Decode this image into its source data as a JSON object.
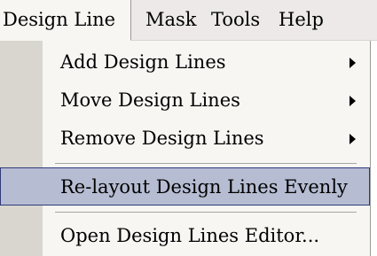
{
  "menubar": {
    "items": [
      {
        "label": "Design Line"
      },
      {
        "label": "Mask"
      },
      {
        "label": "Tools"
      },
      {
        "label": "Help"
      }
    ]
  },
  "dropdown": {
    "items": [
      {
        "label": "Add Design Lines",
        "has_submenu": true
      },
      {
        "label": "Move Design Lines",
        "has_submenu": true
      },
      {
        "label": "Remove Design Lines",
        "has_submenu": true
      },
      {
        "label": "Re-layout Design Lines Evenly",
        "highlighted": true
      },
      {
        "label": "Open Design Lines Editor..."
      }
    ]
  },
  "colors": {
    "menubar_bg": "#ece9e8",
    "menu_bg": "#f7f6f3",
    "gutter": "#d9d6d0",
    "highlight_bg": "#b6bdd2",
    "highlight_border": "#2f3a78"
  }
}
